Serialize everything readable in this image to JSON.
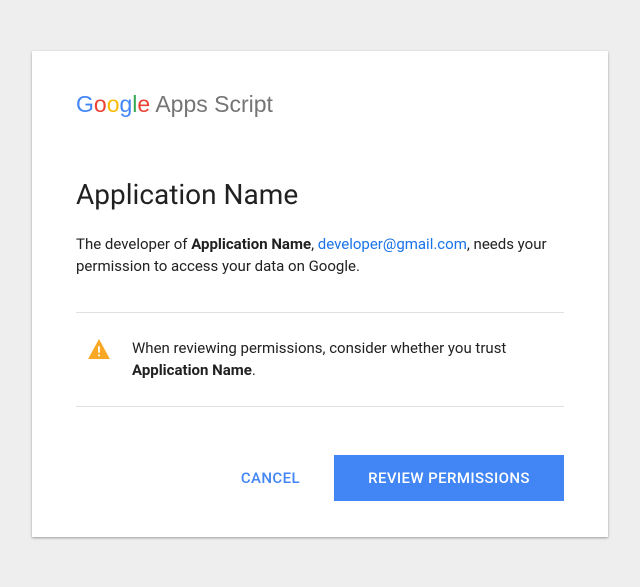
{
  "brand": {
    "g": "G",
    "o1": "o",
    "o2": "o",
    "g2": "g",
    "l": "l",
    "e": "e",
    "rest": " Apps Script"
  },
  "app_title": "Application Name",
  "description": {
    "prefix": "The developer of ",
    "app_name": "Application Name",
    "sep1": ", ",
    "email": "developer@gmail.com",
    "suffix": ", needs your permission to access your data on Google."
  },
  "warning": {
    "prefix": "When reviewing permissions, consider whether you trust ",
    "app_name": "Application Name",
    "suffix": "."
  },
  "actions": {
    "cancel": "CANCEL",
    "review": "REVIEW PERMISSIONS"
  },
  "colors": {
    "primary": "#4285F4",
    "warning": "#F9A825"
  }
}
